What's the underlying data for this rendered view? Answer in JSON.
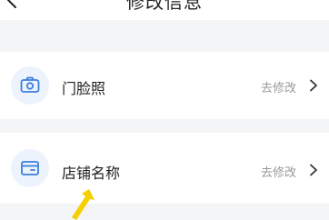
{
  "header": {
    "title": "修改信息",
    "back_icon": "chevron-left-icon"
  },
  "items": [
    {
      "label": "门脸照",
      "action": "去修改",
      "icon": "camera-icon"
    },
    {
      "label": "店铺名称",
      "action": "去修改",
      "icon": "storefront-card-icon"
    }
  ],
  "colors": {
    "accent": "#3b7ddd",
    "icon_bg": "#edf3fd",
    "page_bg": "#f4f5f7",
    "action_text": "#999999",
    "pointer": "#f5d000"
  }
}
